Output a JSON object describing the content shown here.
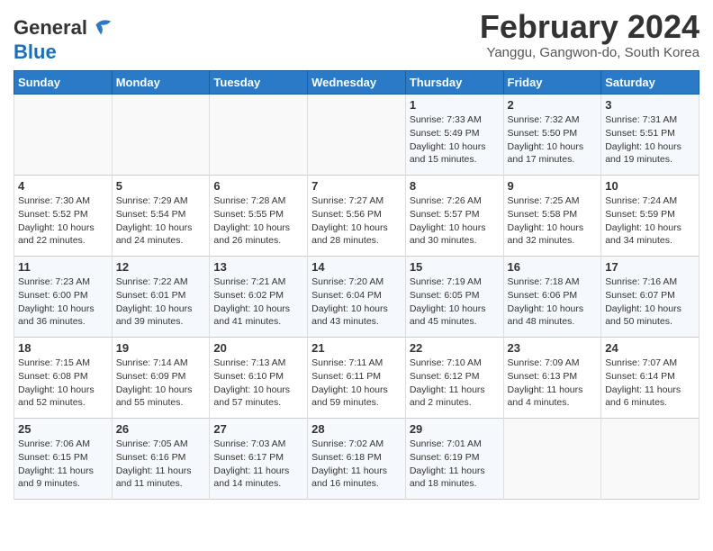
{
  "header": {
    "logo_line1": "General",
    "logo_line2": "Blue",
    "month": "February 2024",
    "location": "Yanggu, Gangwon-do, South Korea"
  },
  "weekdays": [
    "Sunday",
    "Monday",
    "Tuesday",
    "Wednesday",
    "Thursday",
    "Friday",
    "Saturday"
  ],
  "weeks": [
    [
      {
        "day": "",
        "info": ""
      },
      {
        "day": "",
        "info": ""
      },
      {
        "day": "",
        "info": ""
      },
      {
        "day": "",
        "info": ""
      },
      {
        "day": "1",
        "info": "Sunrise: 7:33 AM\nSunset: 5:49 PM\nDaylight: 10 hours\nand 15 minutes."
      },
      {
        "day": "2",
        "info": "Sunrise: 7:32 AM\nSunset: 5:50 PM\nDaylight: 10 hours\nand 17 minutes."
      },
      {
        "day": "3",
        "info": "Sunrise: 7:31 AM\nSunset: 5:51 PM\nDaylight: 10 hours\nand 19 minutes."
      }
    ],
    [
      {
        "day": "4",
        "info": "Sunrise: 7:30 AM\nSunset: 5:52 PM\nDaylight: 10 hours\nand 22 minutes."
      },
      {
        "day": "5",
        "info": "Sunrise: 7:29 AM\nSunset: 5:54 PM\nDaylight: 10 hours\nand 24 minutes."
      },
      {
        "day": "6",
        "info": "Sunrise: 7:28 AM\nSunset: 5:55 PM\nDaylight: 10 hours\nand 26 minutes."
      },
      {
        "day": "7",
        "info": "Sunrise: 7:27 AM\nSunset: 5:56 PM\nDaylight: 10 hours\nand 28 minutes."
      },
      {
        "day": "8",
        "info": "Sunrise: 7:26 AM\nSunset: 5:57 PM\nDaylight: 10 hours\nand 30 minutes."
      },
      {
        "day": "9",
        "info": "Sunrise: 7:25 AM\nSunset: 5:58 PM\nDaylight: 10 hours\nand 32 minutes."
      },
      {
        "day": "10",
        "info": "Sunrise: 7:24 AM\nSunset: 5:59 PM\nDaylight: 10 hours\nand 34 minutes."
      }
    ],
    [
      {
        "day": "11",
        "info": "Sunrise: 7:23 AM\nSunset: 6:00 PM\nDaylight: 10 hours\nand 36 minutes."
      },
      {
        "day": "12",
        "info": "Sunrise: 7:22 AM\nSunset: 6:01 PM\nDaylight: 10 hours\nand 39 minutes."
      },
      {
        "day": "13",
        "info": "Sunrise: 7:21 AM\nSunset: 6:02 PM\nDaylight: 10 hours\nand 41 minutes."
      },
      {
        "day": "14",
        "info": "Sunrise: 7:20 AM\nSunset: 6:04 PM\nDaylight: 10 hours\nand 43 minutes."
      },
      {
        "day": "15",
        "info": "Sunrise: 7:19 AM\nSunset: 6:05 PM\nDaylight: 10 hours\nand 45 minutes."
      },
      {
        "day": "16",
        "info": "Sunrise: 7:18 AM\nSunset: 6:06 PM\nDaylight: 10 hours\nand 48 minutes."
      },
      {
        "day": "17",
        "info": "Sunrise: 7:16 AM\nSunset: 6:07 PM\nDaylight: 10 hours\nand 50 minutes."
      }
    ],
    [
      {
        "day": "18",
        "info": "Sunrise: 7:15 AM\nSunset: 6:08 PM\nDaylight: 10 hours\nand 52 minutes."
      },
      {
        "day": "19",
        "info": "Sunrise: 7:14 AM\nSunset: 6:09 PM\nDaylight: 10 hours\nand 55 minutes."
      },
      {
        "day": "20",
        "info": "Sunrise: 7:13 AM\nSunset: 6:10 PM\nDaylight: 10 hours\nand 57 minutes."
      },
      {
        "day": "21",
        "info": "Sunrise: 7:11 AM\nSunset: 6:11 PM\nDaylight: 10 hours\nand 59 minutes."
      },
      {
        "day": "22",
        "info": "Sunrise: 7:10 AM\nSunset: 6:12 PM\nDaylight: 11 hours\nand 2 minutes."
      },
      {
        "day": "23",
        "info": "Sunrise: 7:09 AM\nSunset: 6:13 PM\nDaylight: 11 hours\nand 4 minutes."
      },
      {
        "day": "24",
        "info": "Sunrise: 7:07 AM\nSunset: 6:14 PM\nDaylight: 11 hours\nand 6 minutes."
      }
    ],
    [
      {
        "day": "25",
        "info": "Sunrise: 7:06 AM\nSunset: 6:15 PM\nDaylight: 11 hours\nand 9 minutes."
      },
      {
        "day": "26",
        "info": "Sunrise: 7:05 AM\nSunset: 6:16 PM\nDaylight: 11 hours\nand 11 minutes."
      },
      {
        "day": "27",
        "info": "Sunrise: 7:03 AM\nSunset: 6:17 PM\nDaylight: 11 hours\nand 14 minutes."
      },
      {
        "day": "28",
        "info": "Sunrise: 7:02 AM\nSunset: 6:18 PM\nDaylight: 11 hours\nand 16 minutes."
      },
      {
        "day": "29",
        "info": "Sunrise: 7:01 AM\nSunset: 6:19 PM\nDaylight: 11 hours\nand 18 minutes."
      },
      {
        "day": "",
        "info": ""
      },
      {
        "day": "",
        "info": ""
      }
    ]
  ]
}
